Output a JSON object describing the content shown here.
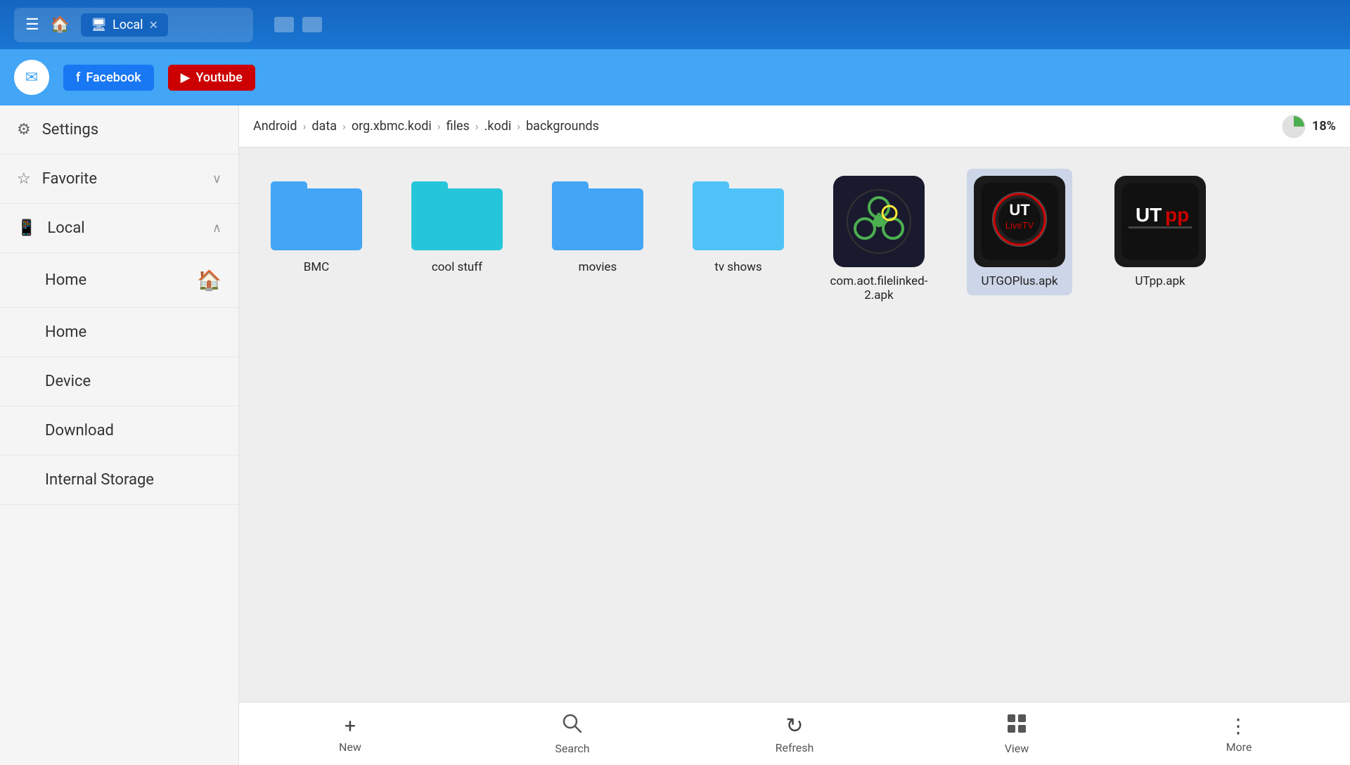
{
  "topbar": {
    "hamburger": "☰",
    "tab_icon": "🖥",
    "tab_label": "Local",
    "tab_close": "✕"
  },
  "socialbar": {
    "mail_icon": "✉",
    "facebook_label": "Facebook",
    "youtube_label": "Youtube"
  },
  "sidebar": {
    "items": [
      {
        "id": "settings",
        "icon": "⚙",
        "label": "Settings",
        "chevron": ""
      },
      {
        "id": "favorite",
        "icon": "☆",
        "label": "Favorite",
        "chevron": "∨"
      },
      {
        "id": "local",
        "icon": "📱",
        "label": "Local",
        "chevron": "∧"
      },
      {
        "id": "home1",
        "icon": "",
        "label": "Home",
        "has_home_icon": true
      },
      {
        "id": "home2",
        "icon": "",
        "label": "Home",
        "has_home_icon": false
      },
      {
        "id": "device",
        "icon": "",
        "label": "Device",
        "has_home_icon": false
      },
      {
        "id": "download",
        "icon": "",
        "label": "Download",
        "has_home_icon": false
      },
      {
        "id": "internal",
        "icon": "",
        "label": "Internal Storage",
        "has_home_icon": false
      }
    ]
  },
  "breadcrumb": {
    "items": [
      "Android",
      "data",
      "org.xbmc.kodi",
      "files",
      ".kodi",
      "backgrounds"
    ],
    "storage_percent": "18%"
  },
  "files": {
    "folders": [
      {
        "id": "bmc",
        "name": "BMC"
      },
      {
        "id": "cool-stuff",
        "name": "cool stuff"
      },
      {
        "id": "movies",
        "name": "movies"
      },
      {
        "id": "tv-shows",
        "name": "tv shows"
      }
    ],
    "apks": [
      {
        "id": "filelinked",
        "name": "com.aot.filelinked-2.apk",
        "selected": false
      },
      {
        "id": "utgoplus",
        "name": "UTGOPlus.apk",
        "selected": true
      },
      {
        "id": "utpp",
        "name": "UTpp.apk",
        "selected": false
      }
    ]
  },
  "toolbar": {
    "buttons": [
      {
        "id": "new",
        "icon": "+",
        "label": "New"
      },
      {
        "id": "search",
        "icon": "🔍",
        "label": "Search"
      },
      {
        "id": "refresh",
        "icon": "↻",
        "label": "Refresh"
      },
      {
        "id": "view",
        "icon": "⊞",
        "label": "View"
      },
      {
        "id": "more",
        "icon": "⋮",
        "label": "More"
      }
    ]
  }
}
